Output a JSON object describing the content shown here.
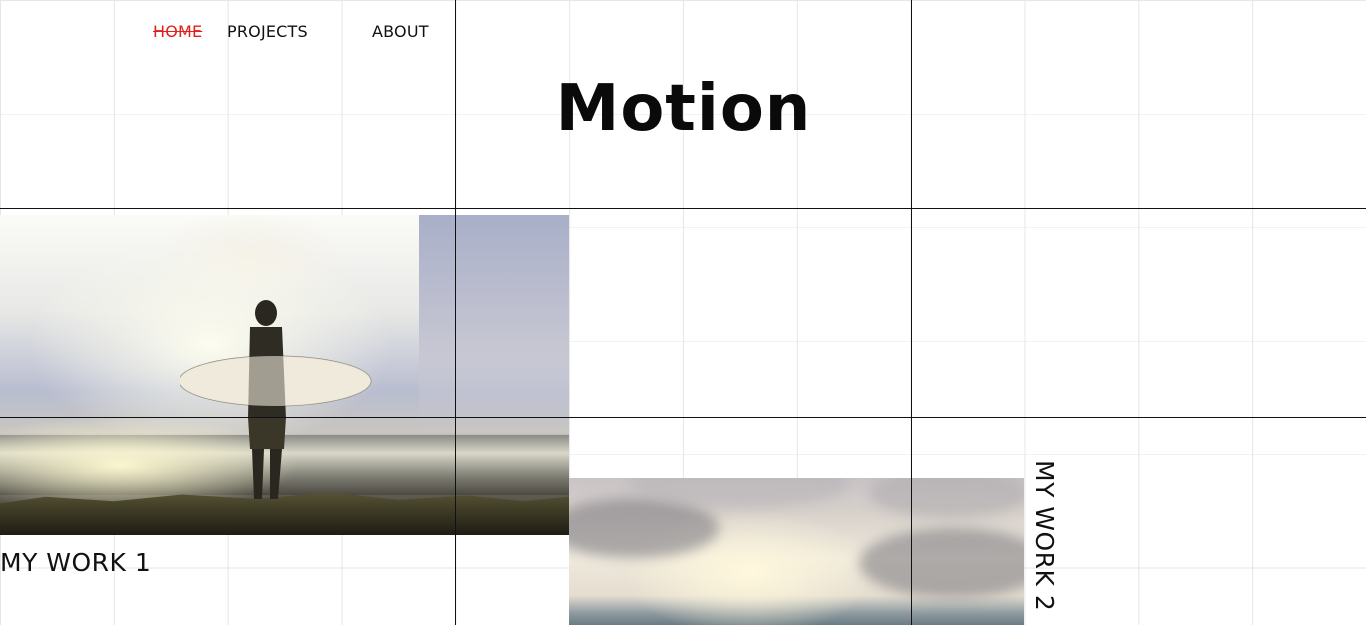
{
  "nav": {
    "items": [
      {
        "label": "HOME",
        "active": true
      },
      {
        "label": "PROJECTS",
        "active": false
      },
      {
        "label": "ABOUT",
        "active": false
      }
    ],
    "active_color": "#e0201b"
  },
  "header": {
    "title": "Motion"
  },
  "works": [
    {
      "label": "MY WORK 1"
    },
    {
      "label": "MY WORK 2"
    }
  ]
}
